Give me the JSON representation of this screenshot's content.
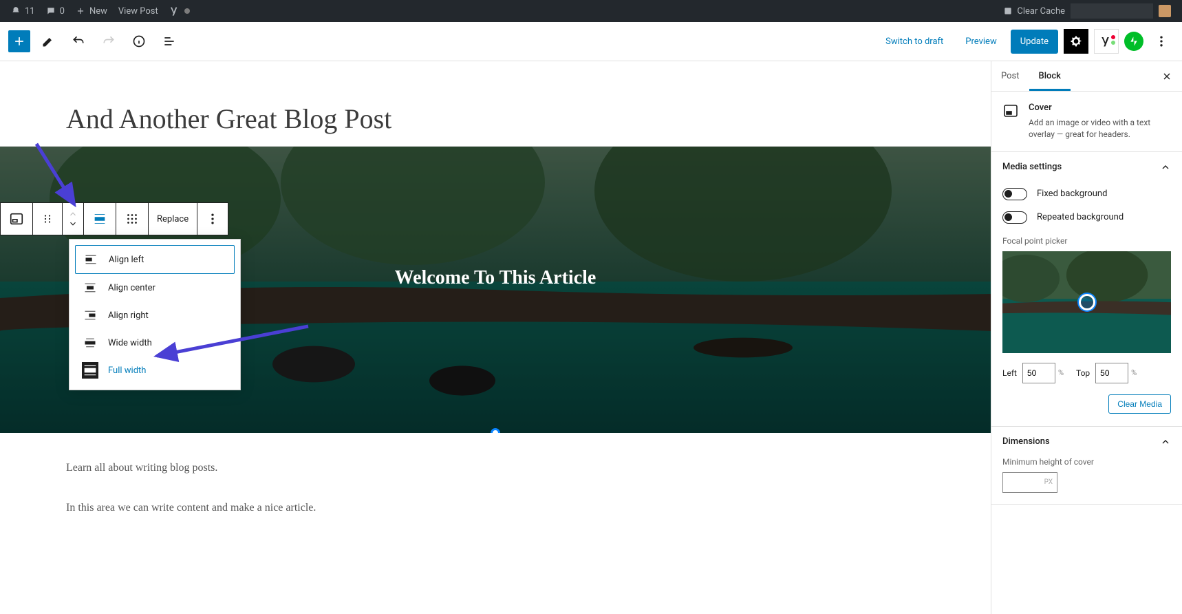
{
  "adminbar": {
    "comments_count": "11",
    "bubble_count": "0",
    "new_label": "New",
    "view_post": "View Post",
    "clear_cache": "Clear Cache"
  },
  "toolbar": {
    "switch_draft": "Switch to draft",
    "preview": "Preview",
    "update": "Update"
  },
  "blockToolbar": {
    "replace": "Replace"
  },
  "alignMenu": {
    "items": [
      {
        "label": "Align left"
      },
      {
        "label": "Align center"
      },
      {
        "label": "Align right"
      },
      {
        "label": "Wide width"
      },
      {
        "label": "Full width"
      }
    ]
  },
  "post": {
    "title": "And Another Great Blog Post",
    "cover_text": "Welcome To This Article",
    "para1": "Learn all about writing blog posts.",
    "para2": "In this area we can write content and make a nice article."
  },
  "sidebar": {
    "tabs": {
      "post": "Post",
      "block": "Block"
    },
    "block": {
      "name": "Cover",
      "desc": "Add an image or video with a text overlay — great for headers."
    },
    "media": {
      "title": "Media settings",
      "fixed": "Fixed background",
      "repeat": "Repeated background",
      "focal": "Focal point picker",
      "left_lbl": "Left",
      "top_lbl": "Top",
      "left_val": "50",
      "top_val": "50",
      "pct": "%",
      "clear": "Clear Media"
    },
    "dims": {
      "title": "Dimensions",
      "min_lbl": "Minimum height of cover",
      "unit": "PX"
    }
  }
}
